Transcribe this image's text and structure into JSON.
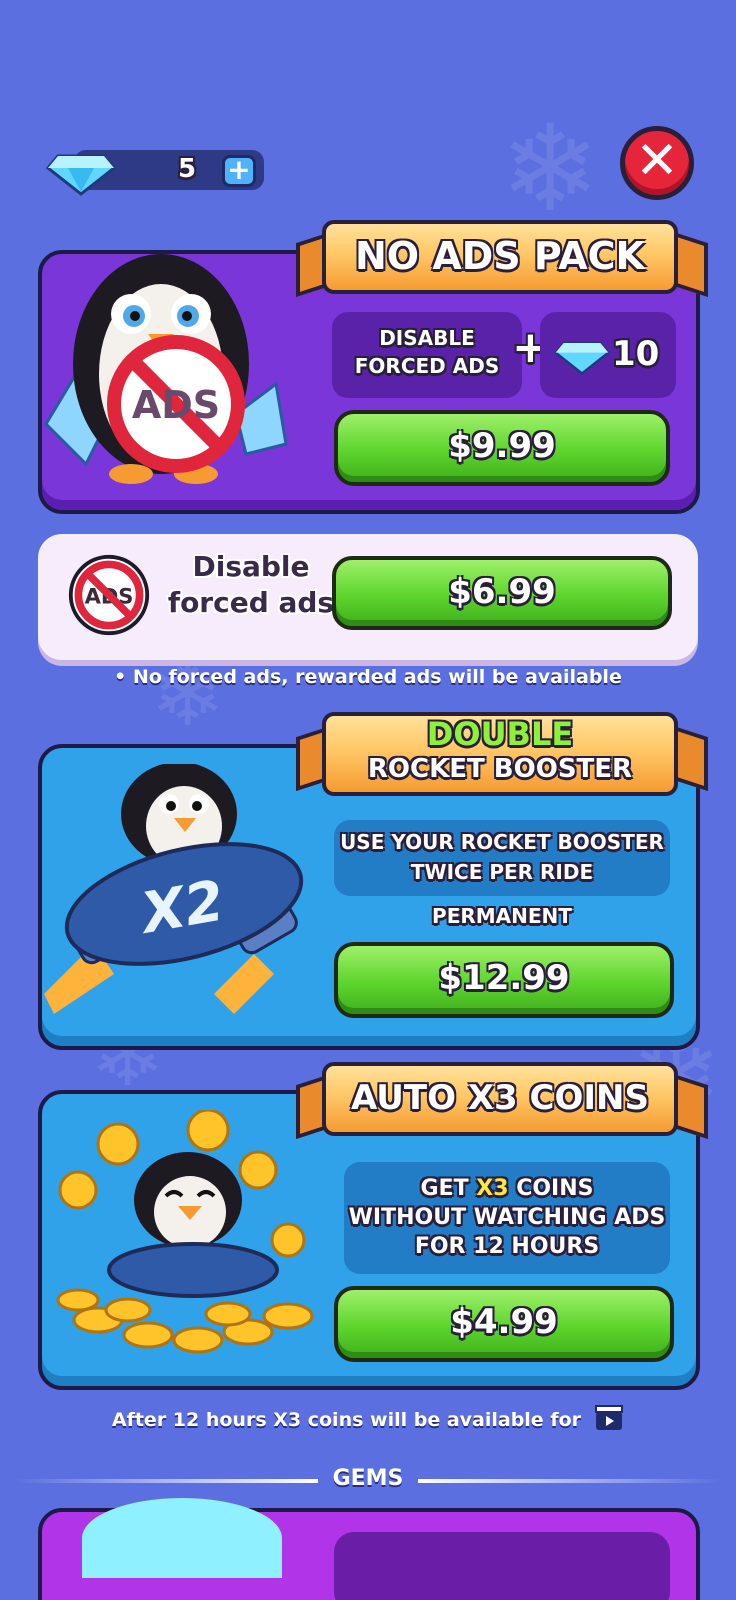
{
  "header": {
    "gem_count": "5",
    "plus_symbol": "+",
    "close_symbol": "✕"
  },
  "no_ads_pack": {
    "title": "NO ADS PACK",
    "feature_line1": "DISABLE",
    "feature_line2": "FORCED ADS",
    "plus_symbol": "+",
    "gem_amount": "10",
    "price": "$9.99",
    "sign_text": "ADS"
  },
  "disable_ads": {
    "label_line1": "Disable",
    "label_line2": "forced ads",
    "price": "$6.99",
    "icon_text": "ADS"
  },
  "note_ads": "• No forced ads, rewarded ads will be available",
  "double_rocket": {
    "title_line1": "DOUBLE",
    "title_line2": "ROCKET BOOSTER",
    "desc_line1": "USE YOUR ROCKET BOOSTER",
    "desc_line2": "TWICE PER RIDE",
    "permanent": "PERMANENT",
    "price": "$12.99",
    "board_text": "X2"
  },
  "auto_coins": {
    "title": "AUTO X3 COINS",
    "desc_prefix": "GET ",
    "desc_highlight": "X3",
    "desc_suffix": " COINS",
    "desc_line2": "WITHOUT WATCHING ADS",
    "desc_line3": "FOR 12 HOURS",
    "price": "$4.99"
  },
  "note_coins": "After 12 hours X3 coins will be available for",
  "gems_section": "GEMS",
  "colors": {
    "background": "#5b6fe0",
    "purple_card": "#7a36d8",
    "blue_card": "#2fa2ea",
    "green_button": "#5dd42c",
    "ribbon_orange": "#ffc766",
    "close_red": "#e6243a",
    "double_green": "#8ef03a"
  },
  "icons": [
    "gem-icon",
    "plus-icon",
    "close-icon",
    "no-ads-icon",
    "video-clapper-icon",
    "snowflake-icon"
  ]
}
